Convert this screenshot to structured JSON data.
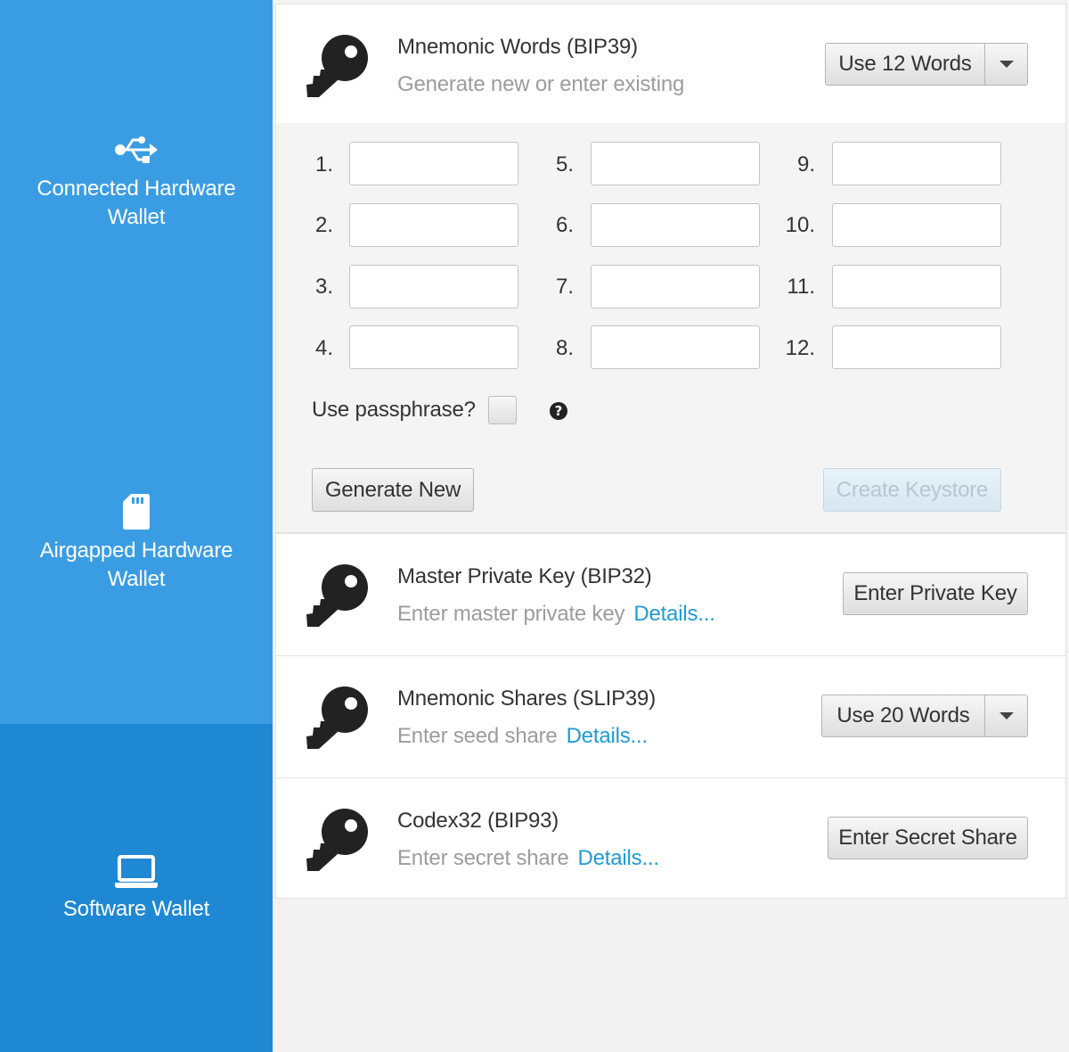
{
  "sidebar": {
    "items": [
      {
        "label": "Connected Hardware Wallet",
        "icon": "usb-icon"
      },
      {
        "label": "Airgapped Hardware Wallet",
        "icon": "sd-card-icon"
      },
      {
        "label": "Software Wallet",
        "icon": "laptop-icon",
        "selected": true
      }
    ]
  },
  "mnemonic": {
    "title": "Mnemonic Words (BIP39)",
    "subtitle": "Generate new or enter existing",
    "word_count_button": "Use 12 Words",
    "word_labels": [
      "1.",
      "2.",
      "3.",
      "4.",
      "5.",
      "6.",
      "7.",
      "8.",
      "9.",
      "10.",
      "11.",
      "12."
    ],
    "passphrase_label": "Use passphrase?",
    "help_icon": "?",
    "generate_button": "Generate New",
    "create_button": "Create Keystore"
  },
  "master_key": {
    "title": "Master Private Key (BIP32)",
    "subtitle": "Enter master private key",
    "details": "Details...",
    "button": "Enter Private Key"
  },
  "slip39": {
    "title": "Mnemonic Shares (SLIP39)",
    "subtitle": "Enter seed share",
    "details": "Details...",
    "button": "Use 20 Words"
  },
  "codex32": {
    "title": "Codex32 (BIP93)",
    "subtitle": "Enter secret share",
    "details": "Details...",
    "button": "Enter Secret Share"
  },
  "colors": {
    "sidebar": "#3a9de3",
    "sidebar_selected": "#1f88d3",
    "link": "#1f9bd6"
  }
}
